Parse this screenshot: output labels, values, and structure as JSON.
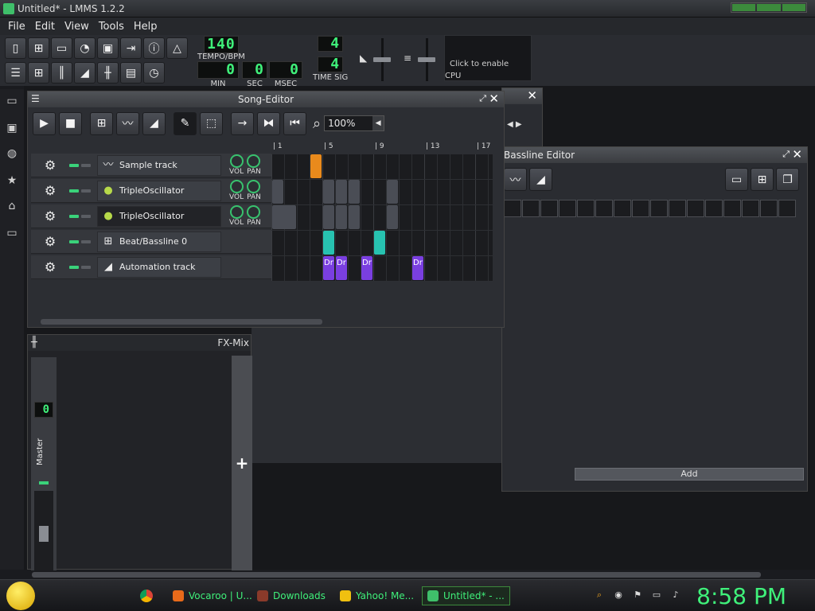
{
  "window": {
    "title": "Untitled* - LMMS 1.2.2"
  },
  "menu": [
    "File",
    "Edit",
    "View",
    "Tools",
    "Help"
  ],
  "tempo": {
    "value": "140",
    "label": "TEMPO/BPM"
  },
  "time": {
    "min": "0",
    "sec": "0",
    "msec": "0",
    "min_label": "MIN",
    "sec_label": "SEC",
    "msec_label": "MSEC"
  },
  "timesig": {
    "num": "4",
    "den": "4",
    "label": "TIME SIG"
  },
  "cpu": {
    "hint": "Click to enable",
    "label": "CPU"
  },
  "song_editor": {
    "title": "Song-Editor",
    "zoom": "100%",
    "ruler": [
      "1",
      "5",
      "9",
      "13",
      "17"
    ],
    "tracks": [
      {
        "name": "Sample track",
        "icon": "waveform-icon",
        "knobs": true
      },
      {
        "name": "TripleOscillator",
        "icon": "instrument-icon",
        "knobs": true
      },
      {
        "name": "TripleOscillator",
        "icon": "instrument-icon",
        "knobs": true,
        "selected": true
      },
      {
        "name": "Beat/Bassline 0",
        "icon": "grid-icon",
        "knobs": false
      },
      {
        "name": "Automation track",
        "icon": "ramp-icon",
        "knobs": false
      }
    ],
    "vol_label": "VOL",
    "pan_label": "PAN",
    "clips": [
      {
        "row": 0,
        "start": 3,
        "len": 1,
        "color": "#e98a1c",
        "text": ""
      },
      {
        "row": 1,
        "start": 0,
        "len": 1,
        "color": "#4a4d55",
        "text": ""
      },
      {
        "row": 1,
        "start": 4,
        "len": 1,
        "color": "#4a4d55",
        "text": ""
      },
      {
        "row": 1,
        "start": 5,
        "len": 1,
        "color": "#4a4d55",
        "text": ""
      },
      {
        "row": 1,
        "start": 6,
        "len": 1,
        "color": "#4a4d55",
        "text": ""
      },
      {
        "row": 1,
        "start": 9,
        "len": 1,
        "color": "#4a4d55",
        "text": ""
      },
      {
        "row": 2,
        "start": 0,
        "len": 2,
        "color": "#4a4d55",
        "text": ""
      },
      {
        "row": 2,
        "start": 4,
        "len": 1,
        "color": "#4a4d55",
        "text": ""
      },
      {
        "row": 2,
        "start": 5,
        "len": 1,
        "color": "#4a4d55",
        "text": ""
      },
      {
        "row": 2,
        "start": 6,
        "len": 1,
        "color": "#4a4d55",
        "text": ""
      },
      {
        "row": 2,
        "start": 9,
        "len": 1,
        "color": "#4a4d55",
        "text": ""
      },
      {
        "row": 3,
        "start": 4,
        "len": 1,
        "color": "#27c2b0",
        "text": ""
      },
      {
        "row": 3,
        "start": 8,
        "len": 1,
        "color": "#27c2b0",
        "text": ""
      },
      {
        "row": 4,
        "start": 4,
        "len": 1,
        "color": "#7a3fe0",
        "text": "Dr"
      },
      {
        "row": 4,
        "start": 5,
        "len": 1,
        "color": "#7a3fe0",
        "text": "Dr"
      },
      {
        "row": 4,
        "start": 7,
        "len": 1,
        "color": "#7a3fe0",
        "text": "Dr"
      },
      {
        "row": 4,
        "start": 11,
        "len": 1,
        "color": "#7a3fe0",
        "text": "Dr"
      }
    ]
  },
  "bb_editor": {
    "title": "Bassline Editor"
  },
  "fx_mixer": {
    "title": "FX-Mix",
    "master": "Master",
    "channel_lcd": "0"
  },
  "add_label": "Add",
  "taskbar": {
    "tasks": [
      {
        "label": "Vocaroo | U...",
        "color": "#e86a1a"
      },
      {
        "label": "Downloads",
        "color": "#8a3a2a"
      },
      {
        "label": "Yahoo! Me...",
        "color": "#f0c010"
      },
      {
        "label": "Untitled* - ...",
        "color": "#3fbf6a",
        "active": true
      }
    ],
    "clock": "8:58 PM"
  },
  "colors": {
    "accent": "#3ff07a",
    "knob": "#38c26e",
    "orange_clip": "#e98a1c",
    "teal_clip": "#27c2b0",
    "purple_clip": "#7a3fe0"
  }
}
